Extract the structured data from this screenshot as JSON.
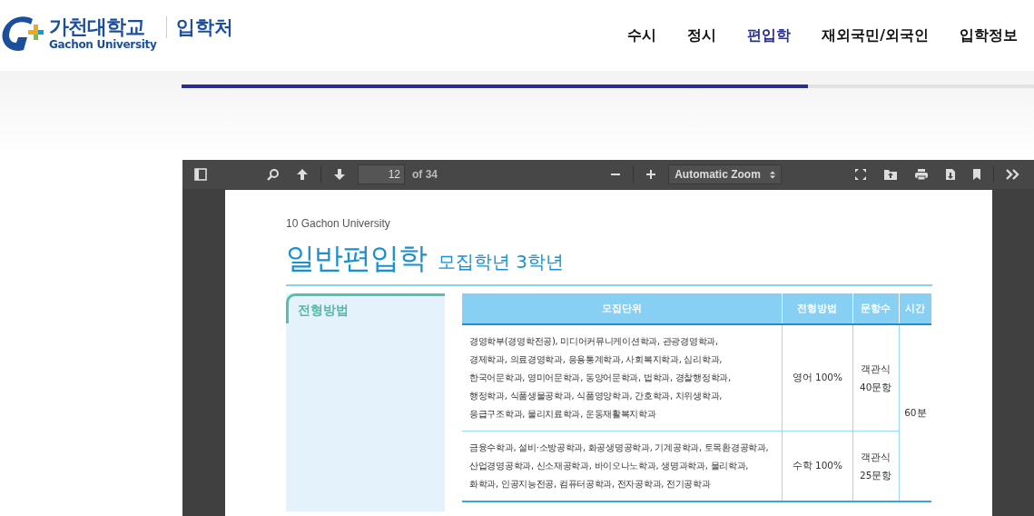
{
  "header": {
    "logo": {
      "name_ko": "가천대학교",
      "name_en": "Gachon University",
      "section": "입학처"
    },
    "nav": [
      {
        "label": "수시",
        "selected": false
      },
      {
        "label": "정시",
        "selected": false
      },
      {
        "label": "편입학",
        "selected": true
      },
      {
        "label": "재외국민/외국인",
        "selected": false
      },
      {
        "label": "입학정보",
        "selected": false
      }
    ],
    "progress": {
      "level": 0.735
    }
  },
  "viewer": {
    "toolbar": {
      "page": "12",
      "page_count": "of 34",
      "zoom": "Automatic Zoom"
    },
    "document": {
      "running_head": "10  Gachon University",
      "title": "일반편입학",
      "subtitle": "모집학년 3학년",
      "side_label": "전형방법",
      "table": {
        "columns": [
          "모집단위",
          "전형방법",
          "문항수",
          "시간"
        ],
        "rows": [
          {
            "units": "경영학부(경영학전공), 미디어커뮤니케이션학과, 관광경영학과,\n경제학과, 의료경영학과, 응용통계학과, 사회복지학과, 심리학과,\n한국어문학과, 영미어문학과, 동양어문학과, 법학과, 경찰행정학과,\n행정학과, 식품생물공학과, 식품영양학과, 간호학과, 치위생학과,\n응급구조학과, 물리치료학과, 운동재활복지학과",
            "method": "영어 100%",
            "questions": "객관식\n40문항"
          },
          {
            "units": "금융수학과, 설비·소방공학과, 화공생명공학과, 기계공학과, 토목환경공학과,\n산업경영공학과, 신소재공학과, 바이오나노학과, 생명과학과, 물리학과,\n화학과, 인공지능전공, 컴퓨터공학과, 전자공학과, 전기공학과",
            "method": "수학 100%",
            "questions": "객관식\n25문항"
          }
        ],
        "time": "60분"
      }
    }
  }
}
